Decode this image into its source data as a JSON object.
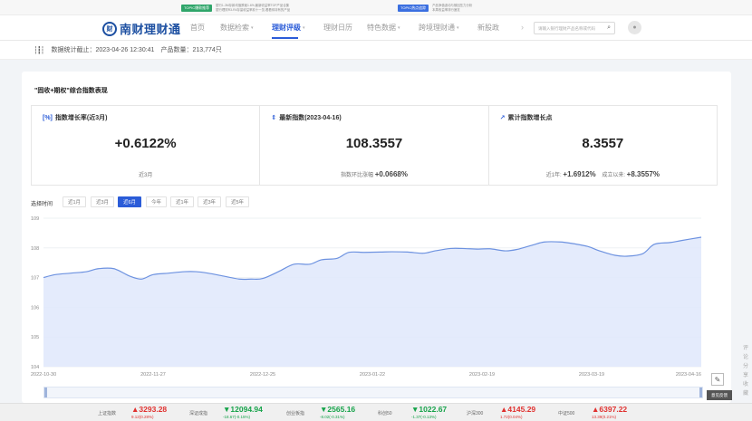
{
  "banner": {
    "ads": [
      {
        "tag": "TOPIC爆款推荐",
        "tag_color": "#2fa56a",
        "line1": "银行1-3M存款均值跌破1.6%,最新收益率TOP产品合集",
        "line2": "银行理财R3-R4存量收益率前十一览,看看你持有的产品"
      },
      {
        "tag": "TOPIC热点追踪",
        "tag_color": "#3b6fe0",
        "line1": "产品净值波动与赎回压力分析",
        "line2": "本周收益率排行速览"
      }
    ]
  },
  "header": {
    "logo_mark": "财",
    "logo_text": "南财理财通",
    "nav": [
      {
        "label": "首页",
        "caret": false,
        "active": false
      },
      {
        "label": "数据检索",
        "caret": true,
        "active": false
      },
      {
        "label": "理财评级",
        "caret": true,
        "active": true
      },
      {
        "label": "理财日历",
        "caret": false,
        "active": false
      },
      {
        "label": "特色数据",
        "caret": true,
        "active": false
      },
      {
        "label": "跨境理财通",
        "caret": true,
        "active": false
      },
      {
        "label": "新股政",
        "caret": false,
        "active": false
      }
    ],
    "search_placeholder": "请输入银行理财产品名称或代码",
    "search_icon": "search-icon",
    "user_icon": "user-icon"
  },
  "stats": {
    "label_date": "数据统计截止：",
    "date": "2023-04-26 12:30:41",
    "label_count": "产品数量：",
    "count": "213,774只"
  },
  "main": {
    "title": "\"固收+期权\"综合指数表现",
    "metrics": [
      {
        "icon": "[%]",
        "label": "指数增长率(近3月)",
        "value": "+0.6122%",
        "sub": "近3月"
      },
      {
        "icon": "⇕",
        "label": "最新指数(2023-04-16)",
        "value": "108.3557",
        "sub_label": "指数环比涨幅",
        "sub_value": "+0.0668%"
      },
      {
        "icon": "↗",
        "label": "累计指数增长点",
        "value": "8.3557",
        "sub_label1": "近1年:",
        "sub_value1": "+1.6912%",
        "sub_label2": "成立以来:",
        "sub_value2": "+8.3557%"
      }
    ],
    "time_label": "选择时间",
    "time_options": [
      "近1月",
      "近3月",
      "近6月",
      "今年",
      "近1年",
      "近3年",
      "近5年"
    ],
    "time_active": "近6月"
  },
  "chart_data": {
    "type": "area",
    "x_ticks": [
      "2022-10-30",
      "2022-11-27",
      "2022-12-25",
      "2023-01-22",
      "2023-02-19",
      "2023-03-19",
      "2023-04-16"
    ],
    "ylim": [
      104,
      109
    ],
    "y_ticks": [
      104,
      105,
      106,
      107,
      108,
      109
    ],
    "series": [
      {
        "x": [
          "2022-10-30",
          "2022-11-02",
          "2022-11-06",
          "2022-11-10",
          "2022-11-13",
          "2022-11-17",
          "2022-11-21",
          "2022-11-24",
          "2022-11-27",
          "2022-12-01",
          "2022-12-05",
          "2022-12-08",
          "2022-12-11",
          "2022-12-15",
          "2022-12-19",
          "2022-12-22",
          "2022-12-25",
          "2022-12-29",
          "2023-01-02",
          "2023-01-06",
          "2023-01-09",
          "2023-01-13",
          "2023-01-16",
          "2023-01-20",
          "2023-01-24",
          "2023-01-27",
          "2023-01-31",
          "2023-02-04",
          "2023-02-07",
          "2023-02-11",
          "2023-02-14",
          "2023-02-18",
          "2023-02-21",
          "2023-02-25",
          "2023-02-28",
          "2023-03-04",
          "2023-03-07",
          "2023-03-11",
          "2023-03-14",
          "2023-03-18",
          "2023-03-21",
          "2023-03-25",
          "2023-03-28",
          "2023-04-01",
          "2023-04-04",
          "2023-04-08",
          "2023-04-11",
          "2023-04-16"
        ],
        "values": [
          107.0,
          107.1,
          107.15,
          107.2,
          107.3,
          107.3,
          107.05,
          106.95,
          107.1,
          107.15,
          107.2,
          107.2,
          107.15,
          107.05,
          106.95,
          106.95,
          106.97,
          107.2,
          107.45,
          107.45,
          107.6,
          107.65,
          107.85,
          107.85,
          107.86,
          107.87,
          107.86,
          107.82,
          107.9,
          107.98,
          107.98,
          107.96,
          107.97,
          107.9,
          107.95,
          108.1,
          108.2,
          108.2,
          108.15,
          108.05,
          107.9,
          107.75,
          107.72,
          107.8,
          108.12,
          108.18,
          108.25,
          108.36
        ]
      }
    ],
    "line_color": "#6d92e0",
    "fill_color": "#dfe8fb",
    "grid": true
  },
  "ticker": [
    {
      "name": "上证指数",
      "value": "3293.28",
      "change": "9.12(0.28%)",
      "dir": "up"
    },
    {
      "name": "深证成指",
      "value": "12094.94",
      "change": "-18.67(-0.15%)",
      "dir": "down"
    },
    {
      "name": "创业板指",
      "value": "2565.16",
      "change": "-8.02(-0.31%)",
      "dir": "down"
    },
    {
      "name": "科创50",
      "value": "1022.67",
      "change": "-1.37(-0.13%)",
      "dir": "down"
    },
    {
      "name": "沪深300",
      "value": "4145.29",
      "change": "1.72(0.04%)",
      "dir": "up"
    },
    {
      "name": "中证500",
      "value": "6397.22",
      "change": "13.39(0.21%)",
      "dir": "up"
    }
  ],
  "tools": {
    "feedback_icon": "edit-icon",
    "feedback_label": "意见反馈",
    "side_chars": [
      "评",
      "论",
      "分",
      "享",
      "收",
      "藏"
    ]
  }
}
